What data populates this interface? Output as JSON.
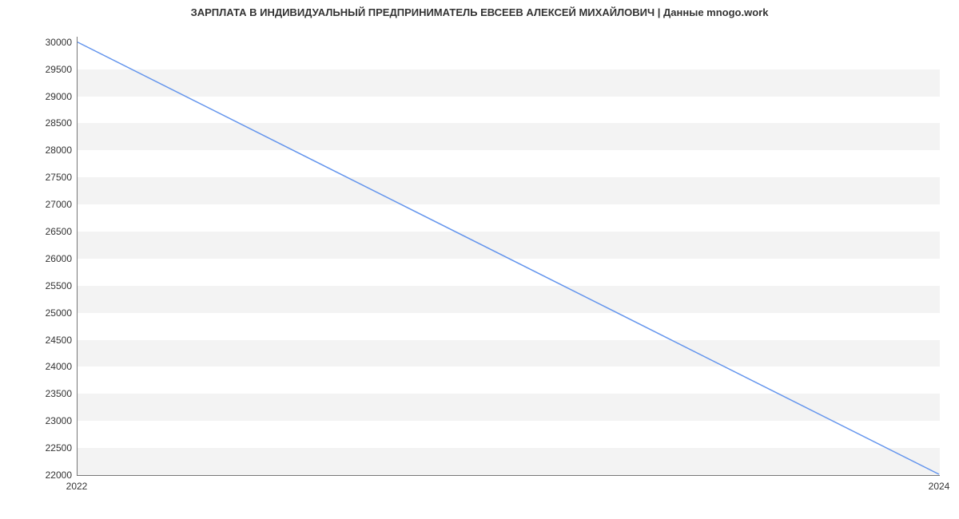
{
  "chart_data": {
    "type": "line",
    "title": "ЗАРПЛАТА В ИНДИВИДУАЛЬНЫЙ ПРЕДПРИНИМАТЕЛЬ ЕВСЕЕВ АЛЕКСЕЙ МИХАЙЛОВИЧ | Данные mnogo.work",
    "x": [
      2022,
      2024
    ],
    "values": [
      30000,
      22000
    ],
    "x_ticks": [
      2022,
      2024
    ],
    "y_ticks": [
      22000,
      22500,
      23000,
      23500,
      24000,
      24500,
      25000,
      25500,
      26000,
      26500,
      27000,
      27500,
      28000,
      28500,
      29000,
      29500,
      30000
    ],
    "xlim": [
      2022,
      2024
    ],
    "ylim": [
      22000,
      30100
    ],
    "line_color": "#6495ed",
    "band_color": "#f3f3f3"
  }
}
